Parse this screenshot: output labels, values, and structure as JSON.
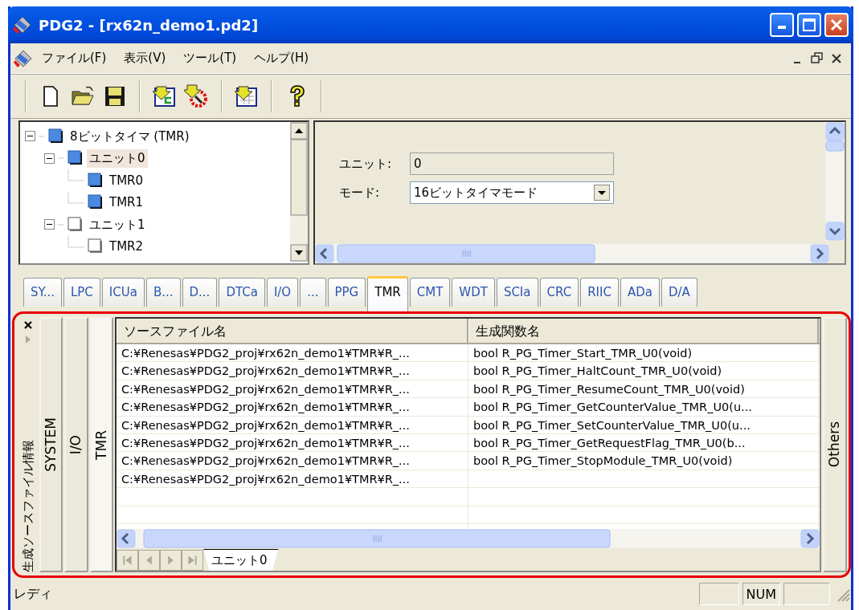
{
  "window": {
    "title": "PDG2 - [rx62n_demo1.pd2]"
  },
  "menu": [
    {
      "label": "ファイル(F)"
    },
    {
      "label": "表示(V)"
    },
    {
      "label": "ツール(T)"
    },
    {
      "label": "ヘルプ(H)"
    }
  ],
  "tree": [
    {
      "label": "8ビットタイマ (TMR)",
      "enabled": true,
      "expanded": true,
      "selected": false,
      "children": [
        {
          "label": "ユニット0",
          "enabled": true,
          "expanded": true,
          "selected": true,
          "children": [
            {
              "label": "TMR0",
              "enabled": true,
              "selected": false
            },
            {
              "label": "TMR1",
              "enabled": true,
              "selected": false
            }
          ]
        },
        {
          "label": "ユニット1",
          "enabled": false,
          "expanded": true,
          "selected": false,
          "children": [
            {
              "label": "TMR2",
              "enabled": false,
              "selected": false
            }
          ]
        }
      ]
    }
  ],
  "properties": [
    {
      "kind": "text",
      "label": "ユニット:",
      "value": "0",
      "disabled": true
    },
    {
      "kind": "select",
      "label": "モード:",
      "value": "16ビットタイマモード",
      "disabled": false
    }
  ],
  "module_tabs": [
    {
      "label": "SY...",
      "selected": false
    },
    {
      "label": "LPC",
      "selected": false
    },
    {
      "label": "ICUa",
      "selected": false
    },
    {
      "label": "B...",
      "selected": false
    },
    {
      "label": "D...",
      "selected": false
    },
    {
      "label": "DTCa",
      "selected": false
    },
    {
      "label": "I/O",
      "selected": false
    },
    {
      "label": "...",
      "selected": false
    },
    {
      "label": "PPG",
      "selected": false
    },
    {
      "label": "TMR",
      "selected": true
    },
    {
      "label": "CMT",
      "selected": false
    },
    {
      "label": "WDT",
      "selected": false
    },
    {
      "label": "SCIa",
      "selected": false
    },
    {
      "label": "CRC",
      "selected": false
    },
    {
      "label": "RIIC",
      "selected": false
    },
    {
      "label": "ADa",
      "selected": false
    },
    {
      "label": "D/A",
      "selected": false
    }
  ],
  "output_panel": {
    "title": "生成ソースファイル情報",
    "left_tabs": [
      {
        "label": "SYSTEM",
        "selected": false
      },
      {
        "label": "I/O",
        "selected": false
      },
      {
        "label": "TMR",
        "selected": true
      }
    ],
    "right_tabs": [
      {
        "label": "Others",
        "selected": false
      }
    ],
    "table": {
      "columns": [
        "ソースファイル名",
        "生成関数名"
      ],
      "rows": [
        {
          "source": "C:¥Renesas¥PDG2_proj¥rx62n_demo1¥TMR¥R_...",
          "function": "bool R_PG_Timer_Start_TMR_U0(void)"
        },
        {
          "source": "C:¥Renesas¥PDG2_proj¥rx62n_demo1¥TMR¥R_...",
          "function": "bool R_PG_Timer_HaltCount_TMR_U0(void)"
        },
        {
          "source": "C:¥Renesas¥PDG2_proj¥rx62n_demo1¥TMR¥R_...",
          "function": "bool R_PG_Timer_ResumeCount_TMR_U0(void)"
        },
        {
          "source": "C:¥Renesas¥PDG2_proj¥rx62n_demo1¥TMR¥R_...",
          "function": "bool R_PG_Timer_GetCounterValue_TMR_U0(u..."
        },
        {
          "source": "C:¥Renesas¥PDG2_proj¥rx62n_demo1¥TMR¥R_...",
          "function": "bool R_PG_Timer_SetCounterValue_TMR_U0(u..."
        },
        {
          "source": "C:¥Renesas¥PDG2_proj¥rx62n_demo1¥TMR¥R_...",
          "function": "bool R_PG_Timer_GetRequestFlag_TMR_U0(b..."
        },
        {
          "source": "C:¥Renesas¥PDG2_proj¥rx62n_demo1¥TMR¥R_...",
          "function": "bool R_PG_Timer_StopModule_TMR_U0(void)"
        },
        {
          "source": "C:¥Renesas¥PDG2_proj¥rx62n_demo1¥TMR¥R_..."
        }
      ]
    },
    "sheet_tabs": [
      {
        "label": "ユニット0",
        "selected": true
      }
    ]
  },
  "status_bar": {
    "message": "レディ",
    "indicators": [
      {
        "label": "NUM"
      }
    ]
  }
}
